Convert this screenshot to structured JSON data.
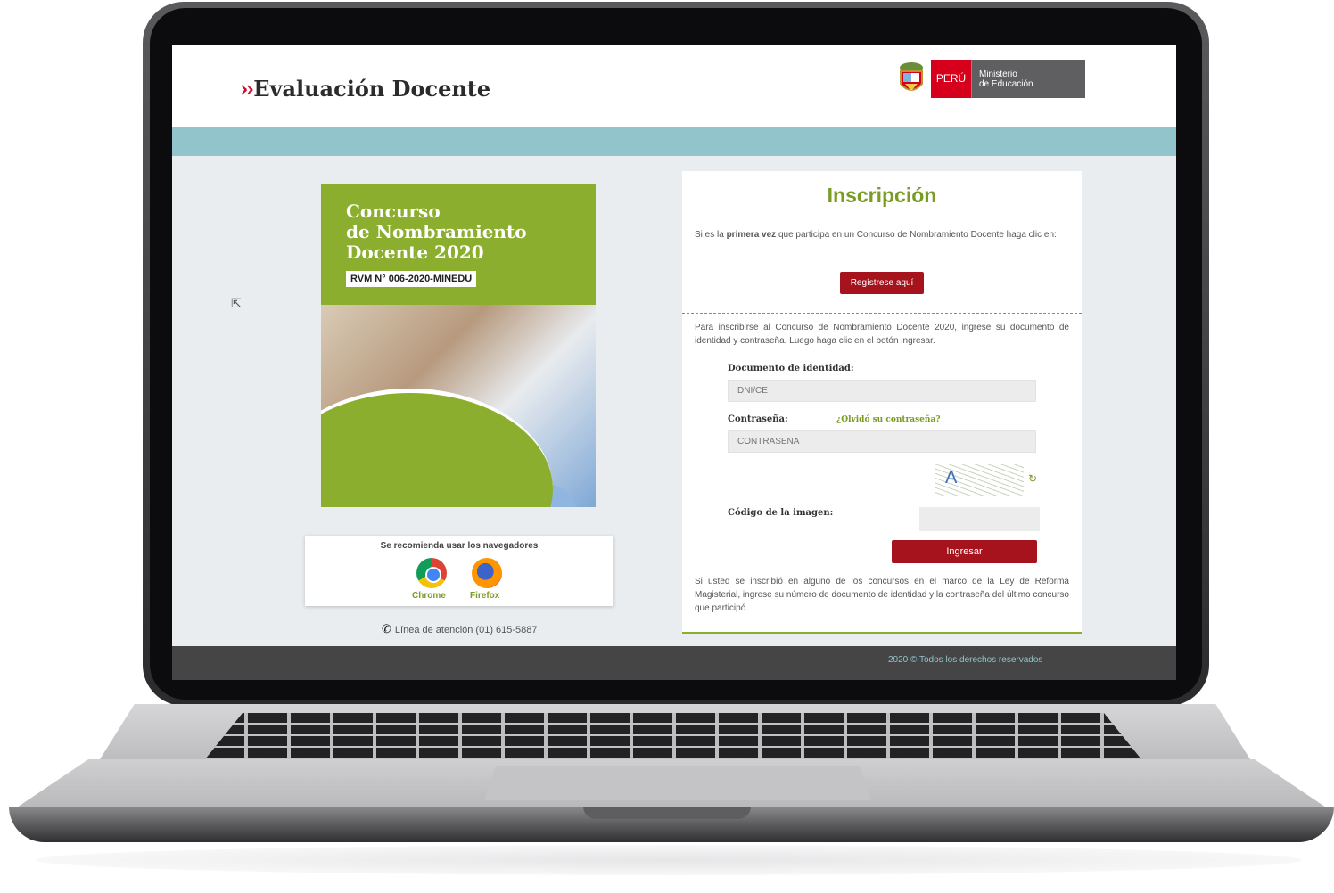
{
  "header": {
    "logo_chevrons": "››",
    "logo_text": "Evaluación Docente",
    "gov_peru": "PERÚ",
    "gov_ministry_line1": "Ministerio",
    "gov_ministry_line2": "de Educación"
  },
  "poster": {
    "title_line1": "Concurso",
    "title_line2": "de Nombramiento",
    "title_line3": "Docente 2020",
    "rvm": "RVM N° 006-2020-MINEDU"
  },
  "browsers": {
    "title": "Se recomienda usar los navegadores",
    "chrome_label": "Chrome",
    "firefox_label": "Firefox"
  },
  "phone": {
    "text": "Línea de atención (01) 615-5887"
  },
  "inscription": {
    "title": "Inscripción",
    "intro_pre": "Si es la ",
    "intro_bold": "primera vez",
    "intro_post": " que participa en un Concurso de Nombramiento Docente haga clic en:",
    "register_button": "Regístrese aquí",
    "login_instructions": "Para inscribirse al Concurso de Nombramiento Docente 2020, ingrese su documento de identidad y contraseña. Luego haga clic en el botón ingresar.",
    "doc_label": "Documento de identidad:",
    "doc_placeholder": "DNI/CE",
    "password_label": "Contraseña:",
    "forgot_link": "¿Olvidó su contraseña?",
    "password_placeholder": "CONTRASEÑA",
    "captcha_text": "A",
    "captcha_code_label": "Código de la imagen:",
    "login_button": "Ingresar",
    "note": "Si usted se inscribió en alguno de los concursos en el marco de la Ley de Reforma Magisterial, ingrese su número de documento de identidad y la contraseña del último concurso que participó."
  },
  "footer": {
    "copyright": "2020 © Todos los derechos reservados"
  },
  "colors": {
    "accent_green": "#8cae2e",
    "button_red": "#a6131c",
    "band_teal": "#92c4cb"
  }
}
